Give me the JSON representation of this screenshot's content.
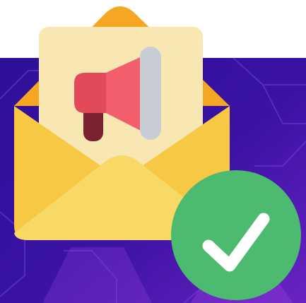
{
  "illustration": {
    "icons": [
      "envelope-icon",
      "letter-icon",
      "megaphone-icon",
      "checkmark-icon"
    ],
    "colors": {
      "background_top": "#ffffff",
      "background_purple_dark": "#2a0c8c",
      "background_purple_mid": "#4a1bb0",
      "background_purple_light": "#7a2fd0",
      "envelope_flap_back": "#f5a623",
      "envelope_body": "#f6c843",
      "envelope_front_flap": "#f8d966",
      "letter_paper": "#f8e7b3",
      "megaphone_red": "#f25e6b",
      "megaphone_dark_red": "#7a2230",
      "megaphone_grey": "#c8ccd4",
      "check_circle": "#4cbb6f",
      "check_mark": "#ffffff"
    }
  }
}
